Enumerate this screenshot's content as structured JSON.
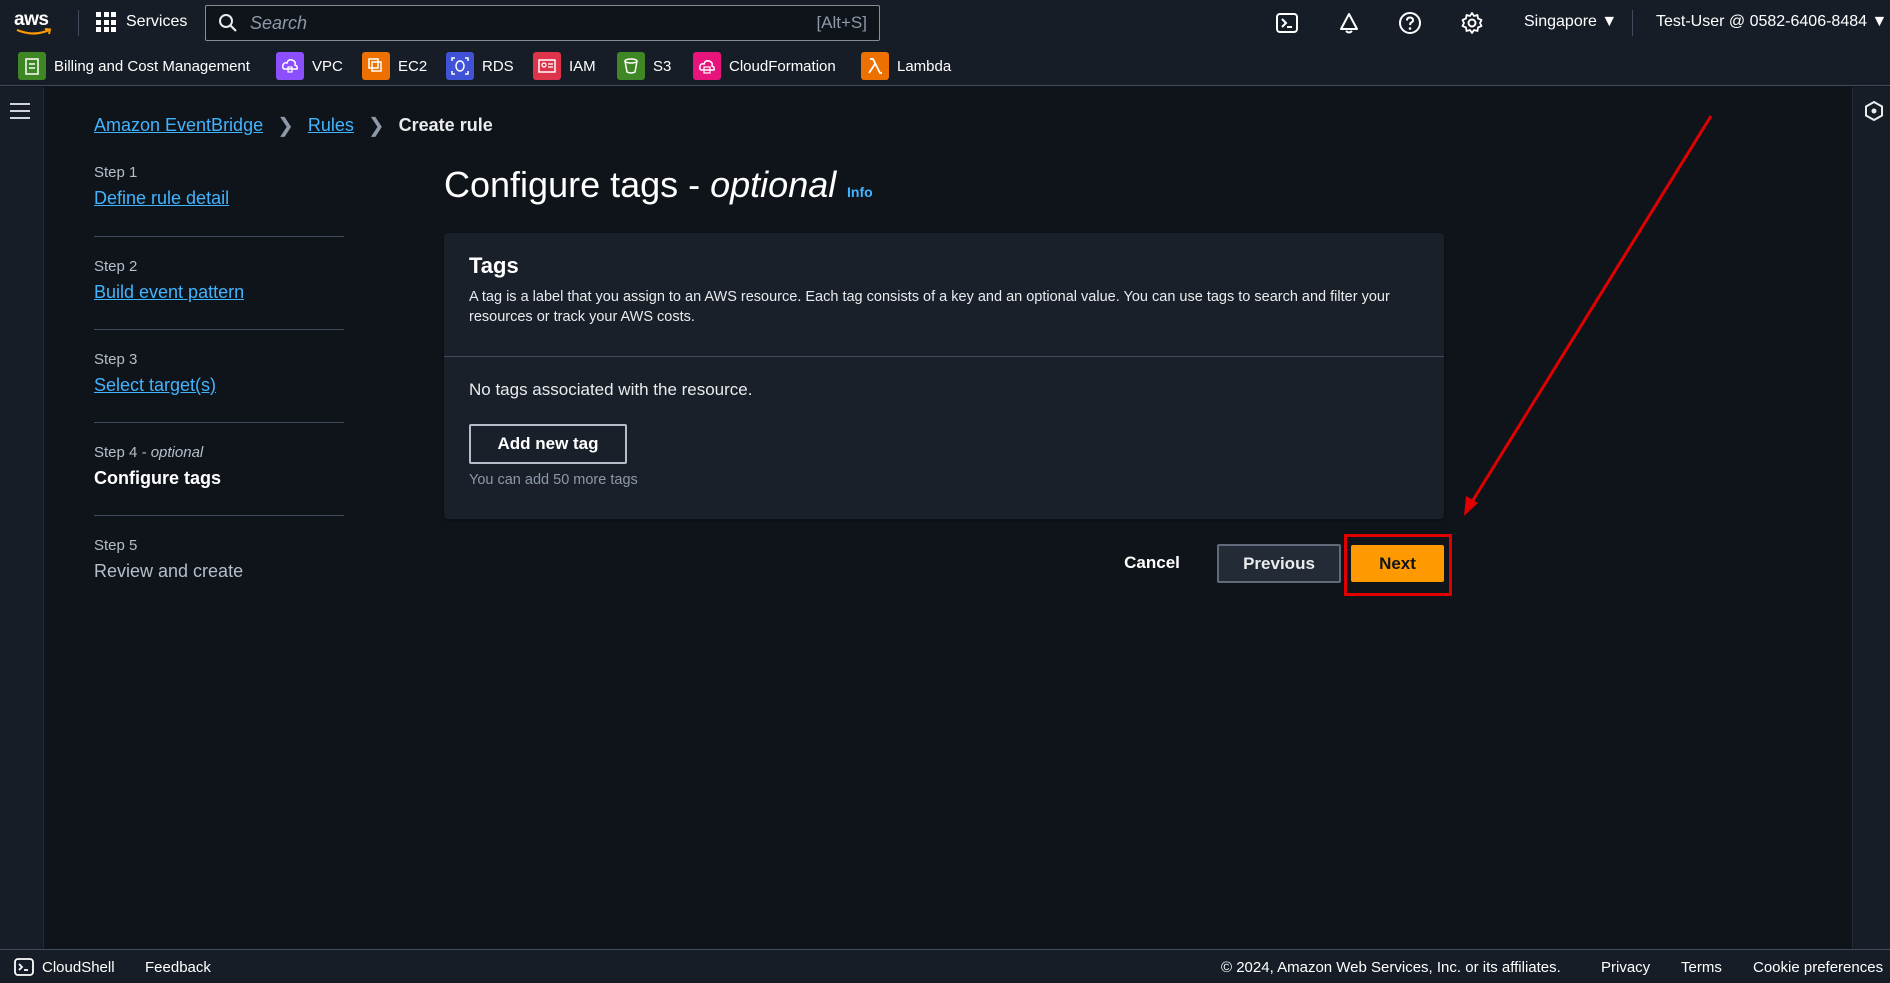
{
  "topnav": {
    "logo_text": "aws",
    "services_label": "Services",
    "search_placeholder": "Search",
    "search_shortcut": "[Alt+S]",
    "region": "Singapore ▼",
    "account": "Test-User @ 0582-6406-8484 ▼",
    "icons": [
      "cloudshell-icon",
      "notifications-icon",
      "help-icon",
      "settings-icon"
    ]
  },
  "favorites": [
    {
      "label": "Billing and Cost Management",
      "color": "#3f8624"
    },
    {
      "label": "VPC",
      "color": "#8c4fff"
    },
    {
      "label": "EC2",
      "color": "#ed7100"
    },
    {
      "label": "RDS",
      "color": "#4053d6"
    },
    {
      "label": "IAM",
      "color": "#dd344c"
    },
    {
      "label": "S3",
      "color": "#3f8624"
    },
    {
      "label": "CloudFormation",
      "color": "#e7157b"
    },
    {
      "label": "Lambda",
      "color": "#ed7100"
    }
  ],
  "breadcrumb": {
    "item1": "Amazon EventBridge",
    "item2": "Rules",
    "current": "Create rule"
  },
  "steps": [
    {
      "num": "Step 1",
      "label": "Define rule detail"
    },
    {
      "num": "Step 2",
      "label": "Build event pattern"
    },
    {
      "num": "Step 3",
      "label": "Select target(s)"
    },
    {
      "num": "Step 4",
      "optional": "- optional",
      "label": "Configure tags"
    },
    {
      "num": "Step 5",
      "label": "Review and create"
    }
  ],
  "main": {
    "title": "Configure tags - ",
    "title_optional": "optional",
    "info": "Info",
    "card_title": "Tags",
    "card_desc": "A tag is a label that you assign to an AWS resource. Each tag consists of a key and an optional value. You can use tags to search and filter your resources or track your AWS costs.",
    "no_tags": "No tags associated with the resource.",
    "add_button": "Add new tag",
    "hint": "You can add 50 more tags",
    "cancel": "Cancel",
    "previous": "Previous",
    "next": "Next"
  },
  "colors": {
    "accent": "#ff9900",
    "link": "#42b4ff",
    "annotation": "#e00000"
  },
  "footer": {
    "cloudshell": "CloudShell",
    "feedback": "Feedback",
    "copyright": "© 2024, Amazon Web Services, Inc. or its affiliates.",
    "privacy": "Privacy",
    "terms": "Terms",
    "cookies": "Cookie preferences"
  }
}
